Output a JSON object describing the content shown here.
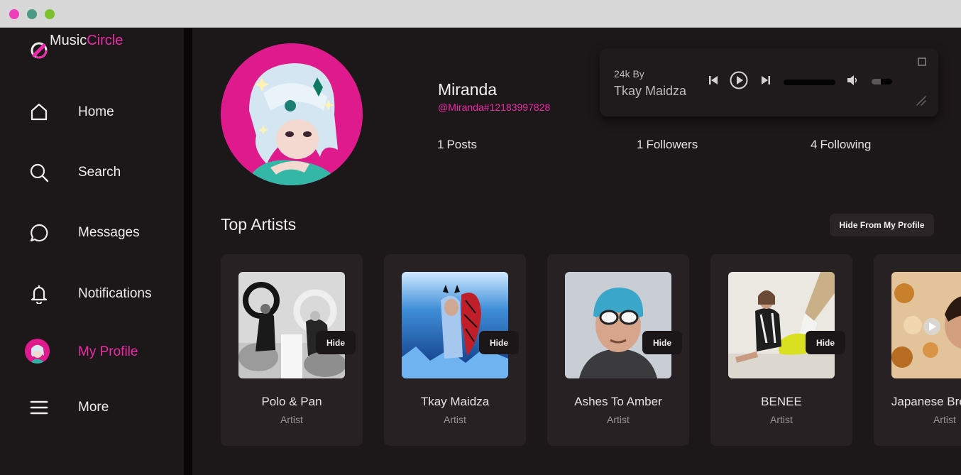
{
  "app": {
    "name_prefix": "Music",
    "name_accent": "Circle",
    "accent_color": "#ee2aa8"
  },
  "sidebar": {
    "items": [
      {
        "label": "Home",
        "icon": "home-icon"
      },
      {
        "label": "Search",
        "icon": "search-icon"
      },
      {
        "label": "Messages",
        "icon": "message-bubble-icon"
      },
      {
        "label": "Notifications",
        "icon": "bell-icon"
      },
      {
        "label": "My Profile",
        "icon": "avatar",
        "active": true
      },
      {
        "label": "More",
        "icon": "hamburger-icon"
      }
    ]
  },
  "profile": {
    "name": "Miranda",
    "handle": "@Miranda#12183997828",
    "posts": {
      "count": "1",
      "label": "Posts"
    },
    "followers": {
      "count": "1",
      "label": "Followers"
    },
    "following": {
      "count": "4",
      "label": "Following"
    }
  },
  "player": {
    "line1": "24k By",
    "line2": "Tkay Maidza",
    "progress": 0,
    "volume": 0.45
  },
  "top_artists": {
    "title": "Top Artists",
    "hide_button": "Hide From My Profile",
    "hide_label": "Hide",
    "artists": [
      {
        "name": "Polo & Pan",
        "type": "Artist"
      },
      {
        "name": "Tkay Maidza",
        "type": "Artist"
      },
      {
        "name": "Ashes To Amber",
        "type": "Artist"
      },
      {
        "name": "BENEE",
        "type": "Artist"
      },
      {
        "name": "Japanese Breakfast",
        "type": "Artist"
      }
    ]
  }
}
